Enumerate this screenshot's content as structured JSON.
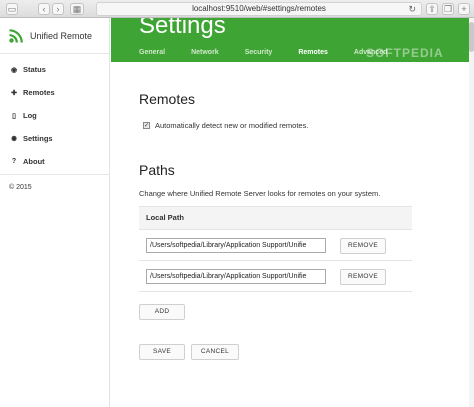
{
  "browser": {
    "url": "localhost:9510/web/#settings/remotes",
    "back_glyph": "‹",
    "forward_glyph": "›",
    "reload_glyph": "↻"
  },
  "sidebar": {
    "brand": "Unified Remote",
    "items": [
      {
        "label": "Status",
        "icon": "dashboard-icon",
        "glyph": "◉"
      },
      {
        "label": "Remotes",
        "icon": "gamepad-icon",
        "glyph": "✚"
      },
      {
        "label": "Log",
        "icon": "file-icon",
        "glyph": "▯"
      },
      {
        "label": "Settings",
        "icon": "gear-icon",
        "glyph": "✺"
      },
      {
        "label": "About",
        "icon": "question-icon",
        "glyph": "?"
      }
    ],
    "copyright": "© 2015"
  },
  "header": {
    "title": "Settings",
    "tabs": [
      "General",
      "Network",
      "Security",
      "Remotes",
      "Advanced"
    ],
    "active_tab": "Remotes",
    "watermark": "SOFTPEDIA",
    "color": "#3ea434"
  },
  "remotes": {
    "heading": "Remotes",
    "auto_detect_label": "Automatically detect new or modified remotes.",
    "auto_detect_checked": true
  },
  "paths": {
    "heading": "Paths",
    "description": "Change where Unified Remote Server looks for remotes on your system.",
    "column_header": "Local Path",
    "rows": [
      {
        "value": "/Users/softpedia/Library/Application Support/Unifie",
        "remove_label": "REMOVE"
      },
      {
        "value": "/Users/softpedia/Library/Application Support/Unifie",
        "remove_label": "REMOVE"
      }
    ],
    "add_label": "ADD"
  },
  "actions": {
    "save_label": "SAVE",
    "cancel_label": "CANCEL"
  }
}
